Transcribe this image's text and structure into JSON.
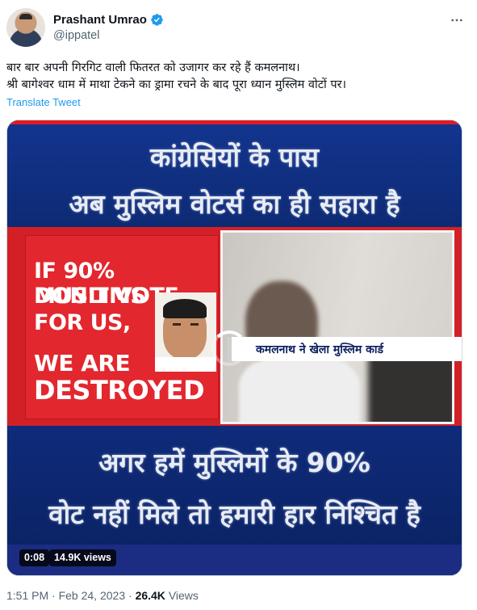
{
  "author": {
    "name": "Prashant Umrao",
    "handle": "@ippatel"
  },
  "tweet": {
    "line1": "बार बार अपनी गिरगिट वाली फितरत को उजागर कर रहे हैं कमलनाथ।",
    "line2": "श्री बागेश्वर धाम में माथा टेकने का ड्रामा रचने के बाद पूरा ध्यान मुस्लिम वोटों पर।",
    "translate_label": "Translate Tweet"
  },
  "video": {
    "headline_top_1": "कांग्रेसियों के पास",
    "headline_top_2": "अब मुस्लिम वोटर्स का ही सहारा है",
    "quote_1": "IF 90% MUSLIMS",
    "quote_2": "DON'T VOTE",
    "quote_3": "FOR US,",
    "quote_4": "WE ARE",
    "quote_5": "DESTROYED",
    "strap_text": "कमलनाथ ने खेला मुस्लिम कार्ड",
    "headline_bottom_1": "अगर हमें मुस्लिमों के 90%",
    "headline_bottom_2": "वोट नहीं मिले तो हमारी हार निश्चित है",
    "duration": "0:08",
    "views_badge": "14.9K views"
  },
  "meta": {
    "time": "1:51 PM",
    "separator": "·",
    "date": "Feb 24, 2023",
    "views_count": "26.4K",
    "views_label": "Views"
  },
  "colors": {
    "link_blue": "#1d9bf0",
    "secondary_text": "#536471",
    "video_blue": "#13358f",
    "video_red": "#d32027"
  },
  "icons": [
    "verified-badge-icon",
    "more-options-icon",
    "loading-spinner-icon"
  ]
}
